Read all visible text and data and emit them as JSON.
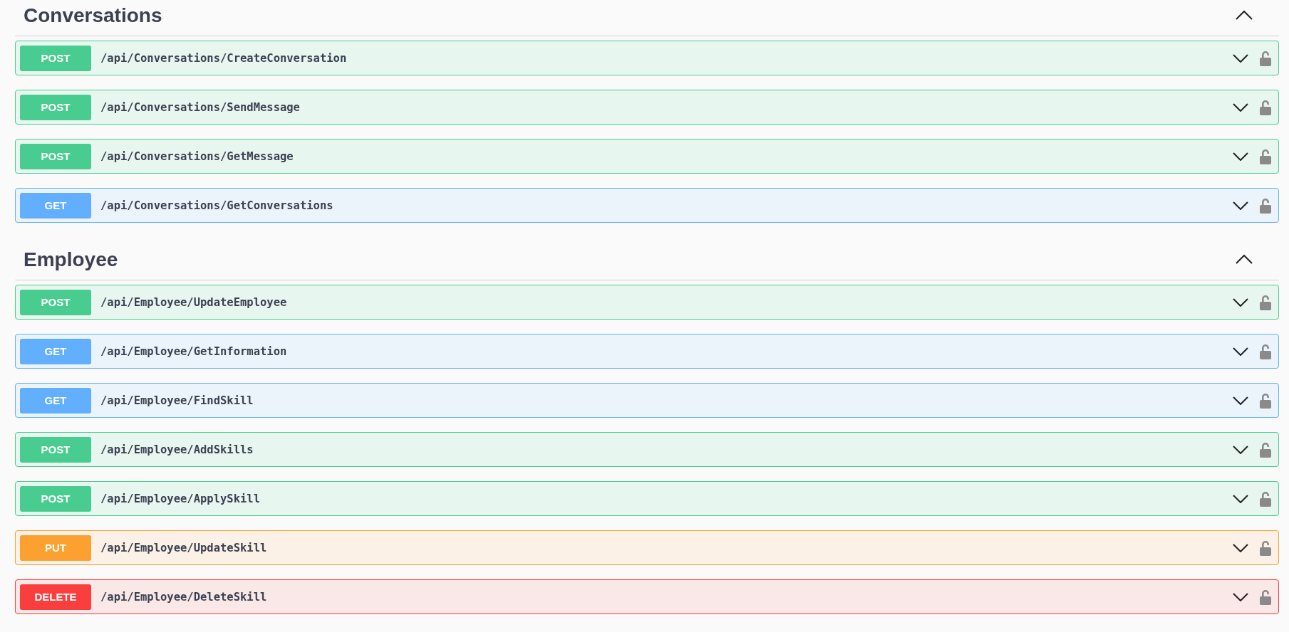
{
  "sections": [
    {
      "title": "Conversations",
      "expanded": true,
      "operations": [
        {
          "kind": "post",
          "method": "POST",
          "path": "/api/Conversations/CreateConversation"
        },
        {
          "kind": "post",
          "method": "POST",
          "path": "/api/Conversations/SendMessage"
        },
        {
          "kind": "post",
          "method": "POST",
          "path": "/api/Conversations/GetMessage"
        },
        {
          "kind": "get",
          "method": "GET",
          "path": "/api/Conversations/GetConversations"
        }
      ]
    },
    {
      "title": "Employee",
      "expanded": true,
      "operations": [
        {
          "kind": "post",
          "method": "POST",
          "path": "/api/Employee/UpdateEmployee"
        },
        {
          "kind": "get",
          "method": "GET",
          "path": "/api/Employee/GetInformation"
        },
        {
          "kind": "get",
          "method": "GET",
          "path": "/api/Employee/FindSkill"
        },
        {
          "kind": "post",
          "method": "POST",
          "path": "/api/Employee/AddSkills"
        },
        {
          "kind": "post",
          "method": "POST",
          "path": "/api/Employee/ApplySkill"
        },
        {
          "kind": "put",
          "method": "PUT",
          "path": "/api/Employee/UpdateSkill"
        },
        {
          "kind": "delete",
          "method": "DELETE",
          "path": "/api/Employee/DeleteSkill"
        }
      ]
    }
  ]
}
